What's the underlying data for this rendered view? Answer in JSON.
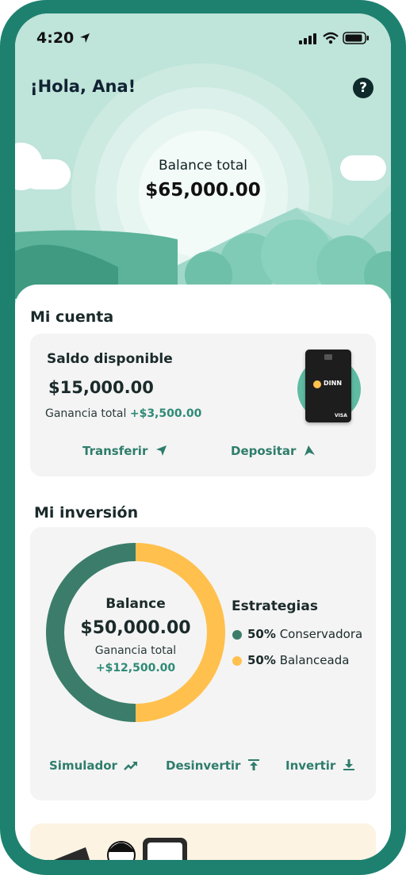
{
  "status": {
    "time": "4:20"
  },
  "header": {
    "greeting": "¡Hola, Ana!",
    "help_icon": "question-circle-icon"
  },
  "hero": {
    "balance_label": "Balance total",
    "balance_value": "$65,000.00"
  },
  "account": {
    "title": "Mi cuenta",
    "available_label": "Saldo disponible",
    "available_value": "$15,000.00",
    "gain_label": "Ganancia total",
    "gain_value": "+$3,500.00",
    "card_brand": "DINN",
    "card_network": "VISA",
    "transfer_label": "Transferir",
    "deposit_label": "Depositar"
  },
  "investment": {
    "title": "Mi inversión",
    "donut_label": "Balance",
    "donut_value": "$50,000.00",
    "gain_label": "Ganancia total",
    "gain_value": "+$12,500.00",
    "strategies_title": "Estrategias",
    "strategies": [
      {
        "percent": "50%",
        "name": "Conservadora",
        "color": "#3b7d6a"
      },
      {
        "percent": "50%",
        "name": "Balanceada",
        "color": "#ffc04d"
      }
    ],
    "simulator_label": "Simulador",
    "divest_label": "Desinvertir",
    "invest_label": "Invertir"
  },
  "colors": {
    "accent": "#2e8a76",
    "frame": "#1e8170",
    "hero_bg": "#bfe4d9",
    "card_bg": "#f4f4f4"
  }
}
